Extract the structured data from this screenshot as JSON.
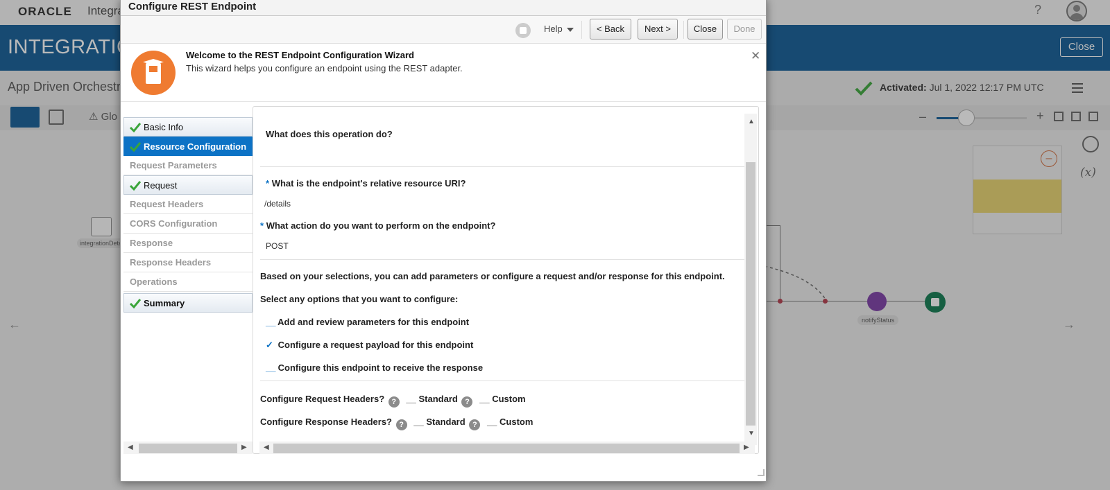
{
  "app": {
    "brand": "ORACLE",
    "brand_sub": "Integra",
    "help_glyph": "?",
    "banner_title": "INTEGRATIC",
    "banner_close": "Close",
    "app_name": "App Driven Orchestr",
    "activated_label": "Activated:",
    "activated_value": "Jul 1, 2022 12:17 PM UTC",
    "toolbar_glo": "Glo",
    "node_left_label": "integrationDeta",
    "notify_label": "notifyStatus"
  },
  "dialog": {
    "title": "Configure REST Endpoint",
    "toolbar": {
      "help": "Help",
      "back": "< Back",
      "next": "Next >",
      "close": "Close",
      "done": "Done"
    },
    "welcome": {
      "title": "Welcome to the REST Endpoint Configuration Wizard",
      "text": "This wizard helps you configure an endpoint using the REST adapter."
    },
    "nav": [
      {
        "label": "Basic Info",
        "state": "done"
      },
      {
        "label": "Resource Configuration",
        "state": "active"
      },
      {
        "label": "Request Parameters",
        "state": "plain"
      },
      {
        "label": "Request",
        "state": "done"
      },
      {
        "label": "Request Headers",
        "state": "plain"
      },
      {
        "label": "CORS Configuration",
        "state": "plain"
      },
      {
        "label": "Response",
        "state": "plain"
      },
      {
        "label": "Response Headers",
        "state": "plain"
      },
      {
        "label": "Operations",
        "state": "plain"
      },
      {
        "label": "Summary",
        "state": "done"
      }
    ],
    "form": {
      "q_operation": "What does this operation do?",
      "q_uri": "What is the endpoint's relative resource URI?",
      "uri_value": "/details",
      "q_action": "What action do you want to perform on the endpoint?",
      "action_value": "POST",
      "info": "Based on your selections, you can add parameters or configure a request and/or response for this endpoint.",
      "select_prompt": "Select any options that you want to configure:",
      "options": [
        {
          "label": "Add and review parameters for this endpoint",
          "checked": false,
          "mark": "__"
        },
        {
          "label": "Configure a request payload for this endpoint",
          "checked": true,
          "mark": "✓"
        },
        {
          "label": "Configure this endpoint to receive the response",
          "checked": false,
          "mark": "__"
        }
      ],
      "req_headers_label": "Configure Request Headers?",
      "resp_headers_label": "Configure Response Headers?",
      "standard": "Standard",
      "custom": "Custom",
      "unchecked_mark": "__",
      "required_mark": "*",
      "help_glyph": "?"
    }
  },
  "colors": {
    "brand_blue": "#0f5b95",
    "active_nav": "#0c72c5",
    "wizard_orange": "#ef7b31",
    "check_green": "#3aa53a"
  }
}
